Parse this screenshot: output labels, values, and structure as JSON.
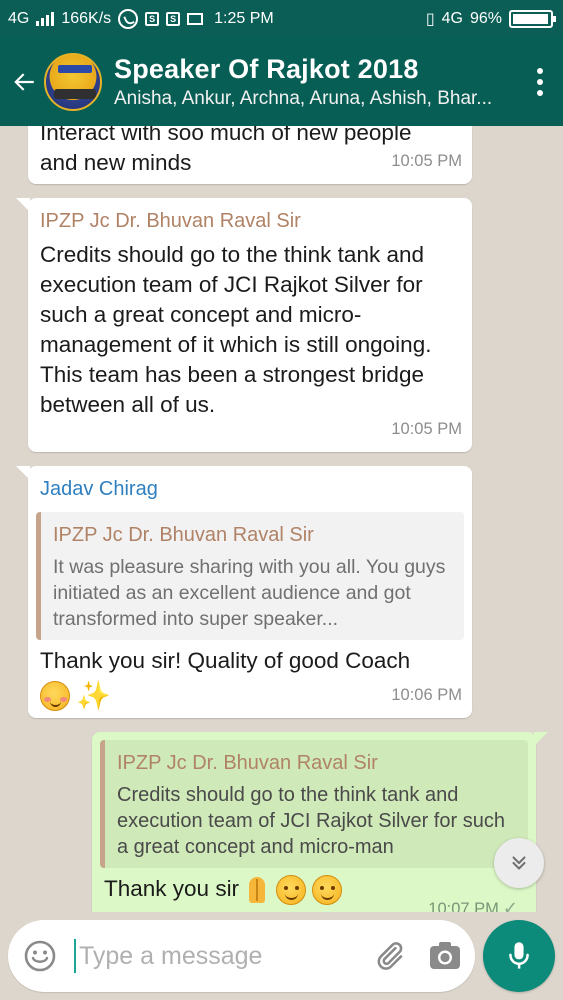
{
  "status_bar": {
    "network_left": "4G",
    "speed": "166K/s",
    "time": "1:25 PM",
    "network_right": "4G",
    "battery": "96%"
  },
  "header": {
    "title": "Speaker Of Rajkot 2018",
    "subtitle": "Anisha, Ankur, Archna, Aruna, Ashish, Bhar..."
  },
  "messages": [
    {
      "text_lines": [
        "Interact with soo much of new people",
        "and new minds"
      ],
      "time": "10:05 PM"
    },
    {
      "sender": "IPZP Jc Dr. Bhuvan Raval Sir",
      "text": "Credits should go to the think tank and execution team of JCI Rajkot Silver for such a great concept and micro-management of it which is still ongoing. This team has been a strongest bridge between all of us.",
      "time": "10:05 PM"
    },
    {
      "sender": "Jadav Chirag",
      "quote_name": "IPZP Jc Dr. Bhuvan Raval Sir",
      "quote_text": "It was pleasure sharing with you all. You guys initiated as an excellent audience and got transformed into super speaker...",
      "text": "Thank you sir! Quality of good Coach",
      "time": "10:06 PM"
    },
    {
      "quote_name": "IPZP Jc Dr. Bhuvan Raval Sir",
      "quote_text": "Credits should go to the think tank and execution team of JCI Rajkot Silver for such a great concept and micro-man",
      "text": "Thank you sir",
      "time": "10:07 PM",
      "status_icon": "single-check-icon"
    }
  ],
  "composer": {
    "placeholder": "Type a message"
  },
  "colors": {
    "header": "#075e54",
    "status_bar": "#0b5e55",
    "chat_bg": "#ddd6cd",
    "outgoing_bubble": "#dcf8c6",
    "sender_quote_name": "#b08266",
    "sender_blue": "#2f7fbf",
    "mic_button": "#0c8a7a"
  }
}
